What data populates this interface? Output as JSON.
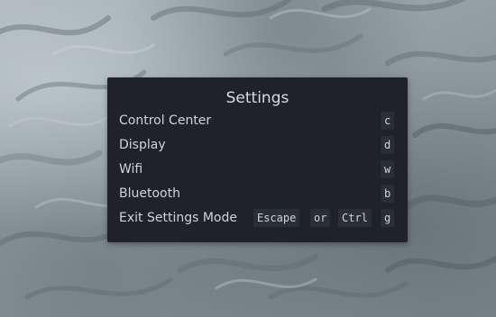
{
  "settings_panel": {
    "title": "Settings",
    "items": [
      {
        "label": "Control Center",
        "key": "c"
      },
      {
        "label": "Display",
        "key": "d"
      },
      {
        "label": "Wifi",
        "key": "w"
      },
      {
        "label": "Bluetooth",
        "key": "b"
      }
    ],
    "exit": {
      "label": "Exit Settings Mode",
      "key_escape": "Escape",
      "separator": "or",
      "key_ctrl": "Ctrl",
      "key_g": "g"
    }
  }
}
